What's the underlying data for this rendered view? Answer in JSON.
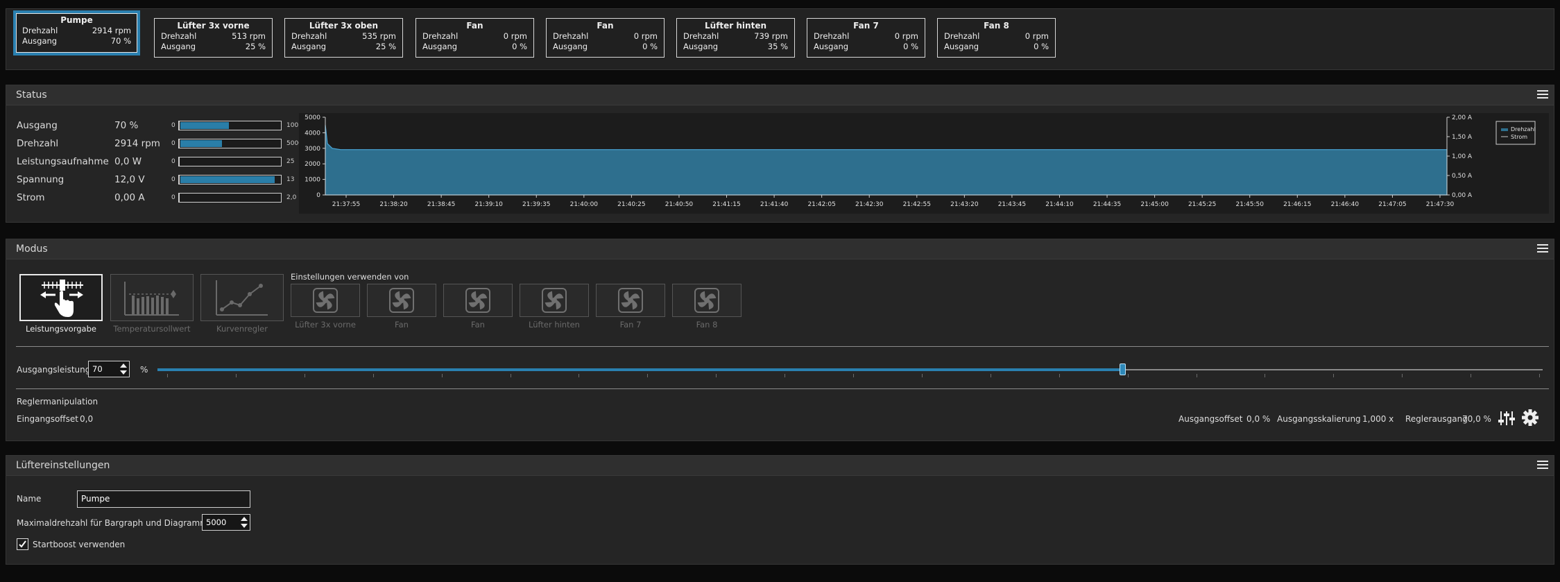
{
  "fans": [
    {
      "name": "Pumpe",
      "drehzahl_label": "Drehzahl",
      "drehzahl": "2914 rpm",
      "ausgang_label": "Ausgang",
      "ausgang": "70 %"
    },
    {
      "name": "Lüfter 3x vorne",
      "drehzahl_label": "Drehzahl",
      "drehzahl": "513 rpm",
      "ausgang_label": "Ausgang",
      "ausgang": "25 %"
    },
    {
      "name": "Lüfter 3x oben",
      "drehzahl_label": "Drehzahl",
      "drehzahl": "535 rpm",
      "ausgang_label": "Ausgang",
      "ausgang": "25 %"
    },
    {
      "name": "Fan",
      "drehzahl_label": "Drehzahl",
      "drehzahl": "0 rpm",
      "ausgang_label": "Ausgang",
      "ausgang": "0 %"
    },
    {
      "name": "Fan",
      "drehzahl_label": "Drehzahl",
      "drehzahl": "0 rpm",
      "ausgang_label": "Ausgang",
      "ausgang": "0 %"
    },
    {
      "name": "Lüfter hinten",
      "drehzahl_label": "Drehzahl",
      "drehzahl": "739 rpm",
      "ausgang_label": "Ausgang",
      "ausgang": "35 %"
    },
    {
      "name": "Fan 7",
      "drehzahl_label": "Drehzahl",
      "drehzahl": "0 rpm",
      "ausgang_label": "Ausgang",
      "ausgang": "0 %"
    },
    {
      "name": "Fan 8",
      "drehzahl_label": "Drehzahl",
      "drehzahl": "0 rpm",
      "ausgang_label": "Ausgang",
      "ausgang": "0 %"
    }
  ],
  "status": {
    "title": "Status",
    "rows": [
      {
        "label": "Ausgang",
        "value": "70 %",
        "min": "0",
        "max": "100",
        "fill": 0.48
      },
      {
        "label": "Drehzahl",
        "value": "2914 rpm",
        "min": "0",
        "max": "5000",
        "fill": 0.41
      },
      {
        "label": "Leistungsaufnahme",
        "value": "0,0 W",
        "min": "0",
        "max": "25",
        "fill": 0
      },
      {
        "label": "Spannung",
        "value": "12,0 V",
        "min": "0",
        "max": "13",
        "fill": 0.93
      },
      {
        "label": "Strom",
        "value": "0,00 A",
        "min": "0",
        "max": "2,0",
        "fill": 0
      }
    ]
  },
  "chart_data": {
    "type": "area",
    "x": [
      "21:37:55",
      "21:38:20",
      "21:38:45",
      "21:39:10",
      "21:39:35",
      "21:40:00",
      "21:40:25",
      "21:40:50",
      "21:41:15",
      "21:41:40",
      "21:42:05",
      "21:42:30",
      "21:42:55",
      "21:43:20",
      "21:43:45",
      "21:44:10",
      "21:44:35",
      "21:45:00",
      "21:45:25",
      "21:45:50",
      "21:46:15",
      "21:46:40",
      "21:47:05",
      "21:47:30"
    ],
    "series": [
      {
        "name": "Drehzahl",
        "axis": "left",
        "color": "#2e6f8e",
        "start_values": [
          4500,
          3300,
          3000,
          2914
        ],
        "values": [
          2914,
          2914,
          2914,
          2914,
          2914,
          2914,
          2914,
          2914,
          2914,
          2914,
          2914,
          2914,
          2914,
          2914,
          2914,
          2914,
          2914,
          2914,
          2914,
          2914,
          2914,
          2914,
          2914,
          2914
        ]
      },
      {
        "name": "Strom",
        "axis": "right",
        "color": "#c8c8c8",
        "values": [
          0,
          0,
          0,
          0,
          0,
          0,
          0,
          0,
          0,
          0,
          0,
          0,
          0,
          0,
          0,
          0,
          0,
          0,
          0,
          0,
          0,
          0,
          0,
          0
        ]
      }
    ],
    "y_left_ticks": [
      "0",
      "1000",
      "2000",
      "3000",
      "4000",
      "5000"
    ],
    "y_right_ticks": [
      "0,00 A",
      "0,50 A",
      "1,00 A",
      "1,50 A",
      "2,00 A"
    ],
    "ylim_left": [
      0,
      5000
    ],
    "ylim_right": [
      0,
      2
    ],
    "legend": "right",
    "grid": false
  },
  "modus": {
    "title": "Modus",
    "modes": [
      {
        "label": "Leistungsvorgabe",
        "icon": "hand-slider-icon",
        "active": true
      },
      {
        "label": "Temperatursollwert",
        "icon": "bar-target-icon",
        "active": false
      },
      {
        "label": "Kurvenregler",
        "icon": "curve-icon",
        "active": false
      }
    ],
    "sources_title": "Einstellungen verwenden von",
    "sources": [
      "Lüfter 3x vorne",
      "Fan",
      "Fan",
      "Lüfter hinten",
      "Fan 7",
      "Fan 8"
    ],
    "ausgangsleistung_label": "Ausgangsleistung",
    "ausgangsleistung_value": "70",
    "ausgangsleistung_unit": "%",
    "slider_fraction": 0.7,
    "reglermanipulation_label": "Reglermanipulation",
    "eingangsoffset_label": "Eingangsoffset",
    "eingangsoffset_value": "0,0",
    "ausgangsoffset_label": "Ausgangsoffset",
    "ausgangsoffset_value": "0,0 %",
    "ausgangsskalierung_label": "Ausgangsskalierung",
    "ausgangsskalierung_value": "1,000 x",
    "reglerausgang_label": "Reglerausgang",
    "reglerausgang_value": "70,0 %"
  },
  "luefter": {
    "title": "Lüftereinstellungen",
    "name_label": "Name",
    "name_value": "Pumpe",
    "max_label": "Maximaldrehzahl für Bargraph und Diagramm",
    "max_value": "5000",
    "startboost_label": "Startboost verwenden",
    "startboost_checked": true
  },
  "colors": {
    "accent": "#2a80b0",
    "panel": "#252525",
    "header": "#2f2f2f",
    "background": "#0b0b0b"
  }
}
